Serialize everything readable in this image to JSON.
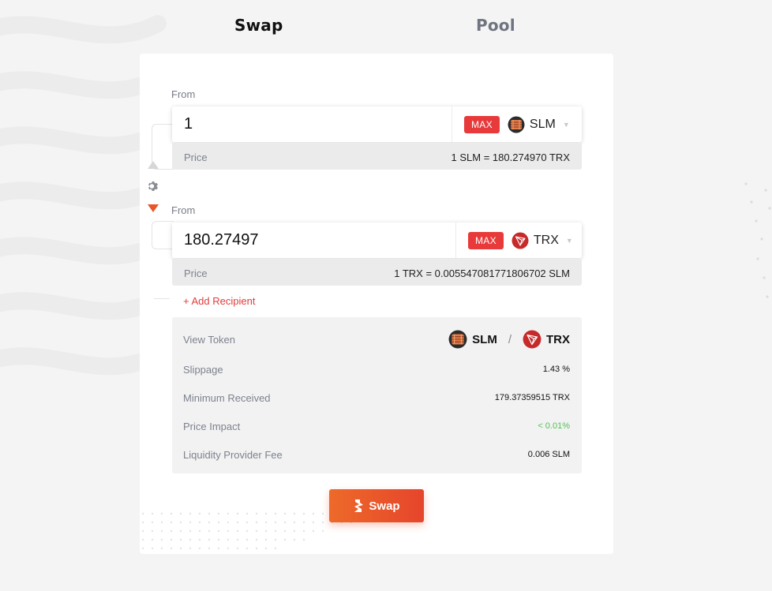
{
  "tabs": [
    {
      "label": "Swap",
      "active": true
    },
    {
      "label": "Pool",
      "active": false
    }
  ],
  "from_top": {
    "label": "From",
    "amount": "1",
    "max_label": "MAX",
    "token": "SLM",
    "token_icon": "slm-token-icon",
    "price_label": "Price",
    "price_value": "1 SLM = 180.274970 TRX"
  },
  "from_bottom": {
    "label": "From",
    "amount": "180.27497",
    "max_label": "MAX",
    "token": "TRX",
    "token_icon": "trx-token-icon",
    "price_label": "Price",
    "price_value": "1 TRX = 0.005547081771806702 SLM"
  },
  "add_recipient": "+ Add Recipient",
  "info": {
    "view_token_label": "View Token",
    "view_token_a": "SLM",
    "view_token_sep": "/",
    "view_token_b": "TRX",
    "slippage_label": "Slippage",
    "slippage_value": "1.43 %",
    "min_received_label": "Minimum Received",
    "min_received_value": "179.37359515 TRX",
    "price_impact_label": "Price Impact",
    "price_impact_value": "< 0.01%",
    "lp_fee_label": "Liquidity Provider Fee",
    "lp_fee_value": "0.006 SLM"
  },
  "swap_button": "Swap",
  "colors": {
    "accent": "#e8552a",
    "max_button": "#e83a3a",
    "add_recipient": "#e23b3b",
    "price_impact": "#4fc34f",
    "tron_red": "#c62a2a"
  }
}
